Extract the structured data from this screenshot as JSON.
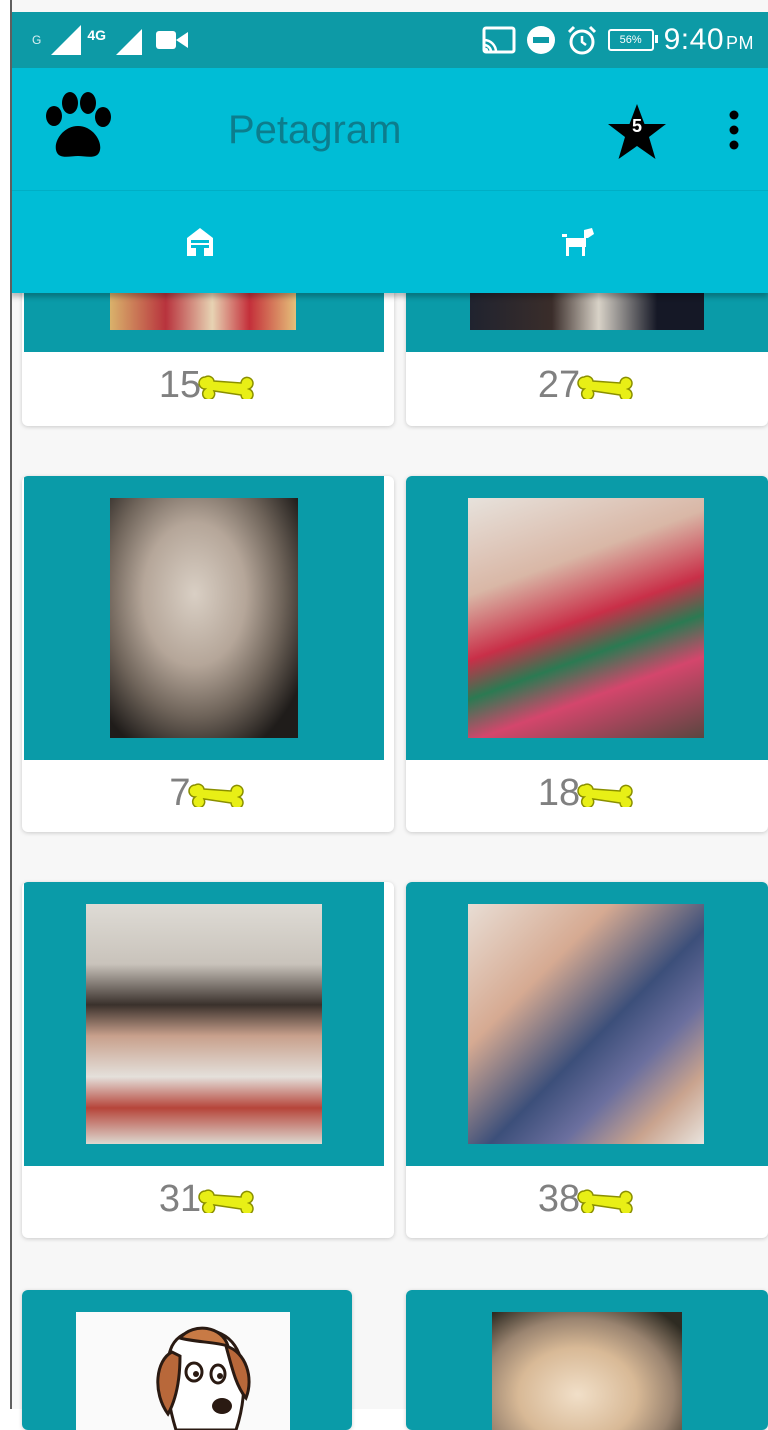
{
  "status_bar": {
    "sim_label": "G",
    "network_label": "4G",
    "battery_percent": "56%",
    "time": "9:40",
    "ampm": "PM"
  },
  "app_bar": {
    "title": "Petagram",
    "favorites_count": "5",
    "logo_icon": "paw-icon",
    "favorites_icon": "star-icon",
    "menu_icon": "more-vert-icon"
  },
  "tabs": [
    {
      "name": "home",
      "icon": "doghouse-icon",
      "selected": true
    },
    {
      "name": "profile",
      "icon": "dog-icon",
      "selected": false
    }
  ],
  "colors": {
    "primary": "#00bdd6",
    "primary_dark": "#0d9aa6",
    "card_media": "#0a9ba8",
    "title": "#0c7d8d",
    "likes_text": "#808080",
    "bone": "#e8ef16"
  },
  "pets": [
    {
      "likes": "15"
    },
    {
      "likes": "27"
    },
    {
      "likes": "7"
    },
    {
      "likes": "18"
    },
    {
      "likes": "31"
    },
    {
      "likes": "38"
    },
    {
      "likes": ""
    },
    {
      "likes": ""
    }
  ]
}
